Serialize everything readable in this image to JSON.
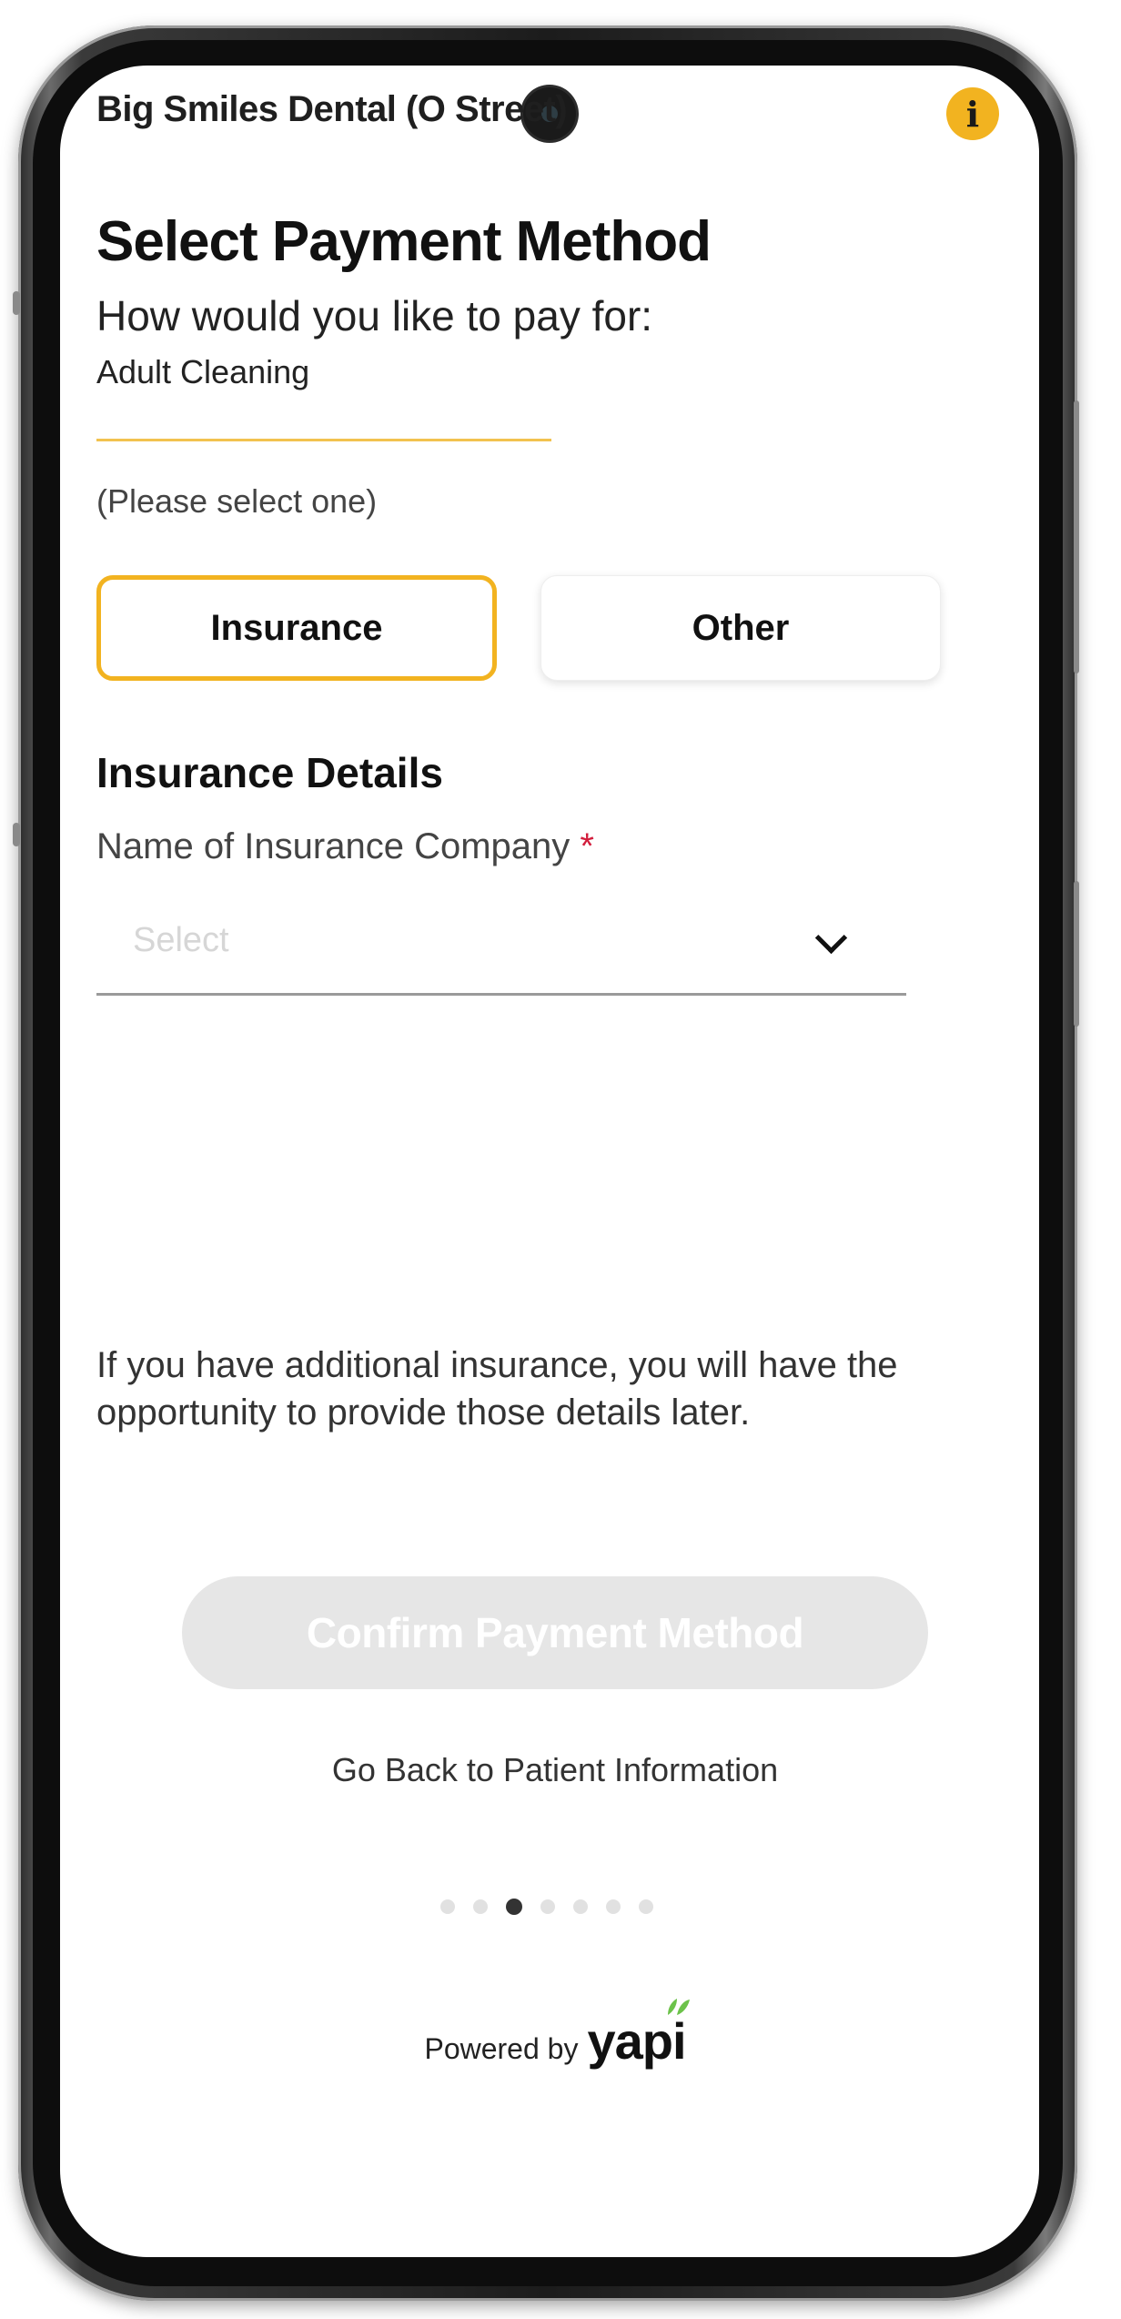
{
  "header": {
    "practice_name": "Big Smiles Dental (O Street)",
    "info_icon": "info-icon",
    "info_glyph": "i"
  },
  "page": {
    "title": "Select Payment Method",
    "subtitle": "How would you like to pay for:",
    "service": "Adult Cleaning",
    "hint": "(Please select one)"
  },
  "payment_options": [
    {
      "label": "Insurance",
      "selected": true
    },
    {
      "label": "Other",
      "selected": false
    }
  ],
  "insurance": {
    "section_title": "Insurance Details",
    "company_label": "Name of Insurance Company",
    "required_mark": "*",
    "select_placeholder": "Select"
  },
  "note": "If you have additional insurance, you will have the opportunity to provide those details later.",
  "actions": {
    "confirm_label": "Confirm Payment Method",
    "back_label": "Go Back to Patient Information"
  },
  "progress": {
    "total_steps": 7,
    "current_step": 3
  },
  "footer": {
    "powered_by": "Powered by",
    "brand": "yapi"
  },
  "colors": {
    "accent": "#f2b320",
    "required": "#d21d3c",
    "disabled_button": "#e6e6e6"
  }
}
